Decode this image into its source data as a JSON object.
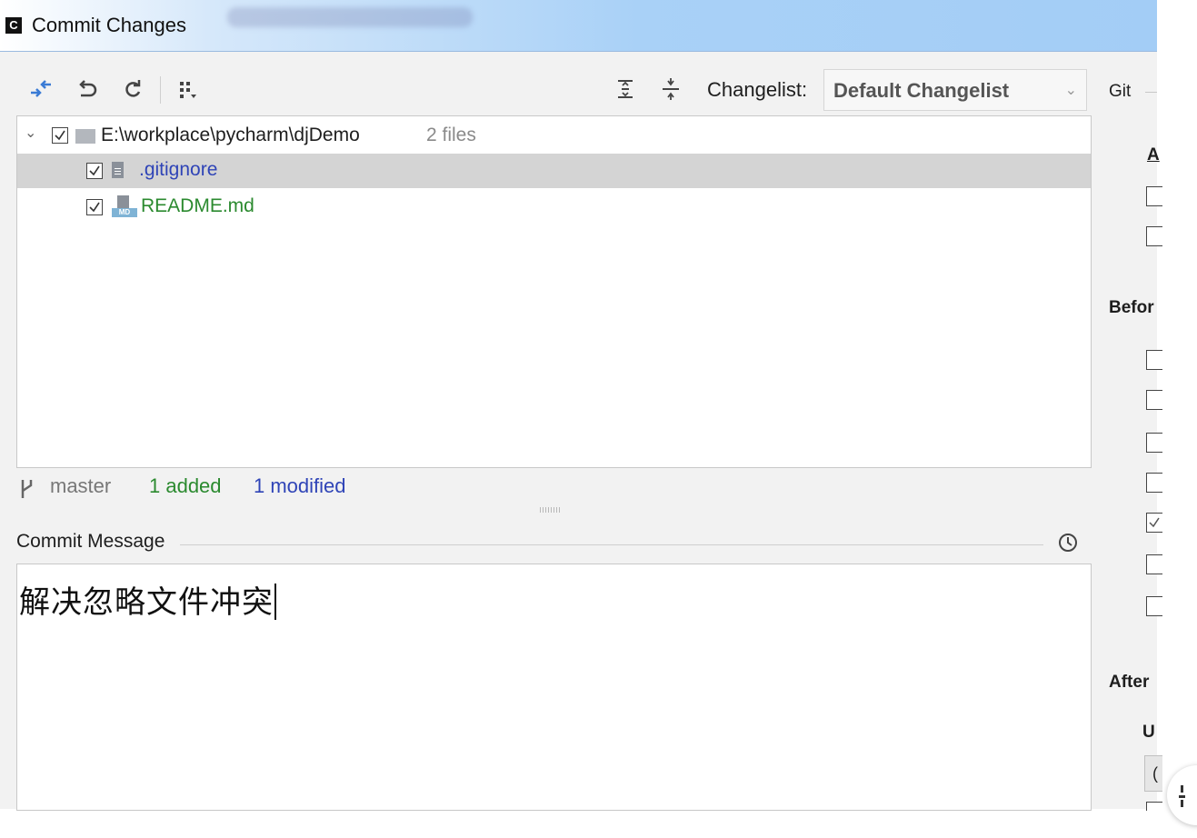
{
  "window": {
    "title": "Commit Changes",
    "app_icon": "pycharm-app-icon"
  },
  "toolbar": {
    "icons": [
      "diff-arrows-icon",
      "rollback-icon",
      "refresh-icon",
      "group-by-icon",
      "expand-all-icon",
      "collapse-all-icon"
    ],
    "changelist_label": "Changelist:",
    "changelist_value": "Default Changelist"
  },
  "tree": {
    "root": {
      "path": "E:\\workplace\\pycharm\\djDemo",
      "count": "2 files",
      "checked": true
    },
    "files": [
      {
        "name": ".gitignore",
        "status": "modified",
        "color": "#2f44b7",
        "checked": true,
        "selected": true,
        "icon": "text-file-icon"
      },
      {
        "name": "README.md",
        "status": "added",
        "color": "#2b8a2f",
        "checked": true,
        "selected": false,
        "icon": "markdown-file-icon"
      }
    ]
  },
  "status_bar": {
    "branch": "master",
    "added": "1 added",
    "modified": "1 modified",
    "added_color": "#2b8a2f",
    "modified_color": "#2f44b7"
  },
  "commit_message": {
    "label": "Commit Message",
    "value": "解决忽略文件冲突"
  },
  "right_panel": {
    "git_label": "Git",
    "author_label": "A",
    "before_label": "Befor",
    "after_label": "After",
    "after_sub_label": "U",
    "combo_value": "(",
    "checkbox_states": [
      false,
      false,
      false,
      false,
      false,
      false,
      true,
      false,
      false
    ]
  }
}
